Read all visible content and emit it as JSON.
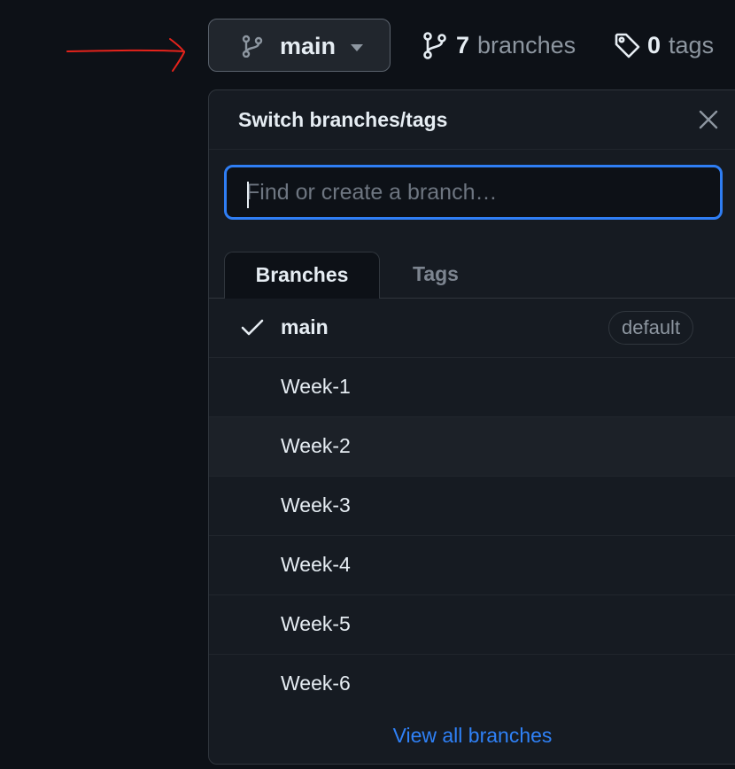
{
  "colors": {
    "accent": "#2f81f7",
    "annotation": "#e5231b",
    "background": "#0d1117",
    "panel": "#161b22"
  },
  "branch_button": {
    "icon": "git-branch-icon",
    "label": "main",
    "caret": "triangle-down-icon"
  },
  "repo_stats": {
    "branches": {
      "icon": "git-branch-icon",
      "count": "7",
      "label": "branches"
    },
    "tags": {
      "icon": "tag-icon",
      "count": "0",
      "label": "tags"
    }
  },
  "dropdown": {
    "title": "Switch branches/tags",
    "close_icon": "x-icon",
    "search": {
      "placeholder": "Find or create a branch…",
      "value": ""
    },
    "tabs": [
      {
        "label": "Branches",
        "active": true
      },
      {
        "label": "Tags",
        "active": false
      }
    ],
    "branches": [
      {
        "name": "main",
        "selected": true,
        "badge": "default"
      },
      {
        "name": "Week-1",
        "selected": false
      },
      {
        "name": "Week-2",
        "selected": false,
        "hovered": true
      },
      {
        "name": "Week-3",
        "selected": false
      },
      {
        "name": "Week-4",
        "selected": false
      },
      {
        "name": "Week-5",
        "selected": false
      },
      {
        "name": "Week-6",
        "selected": false
      }
    ],
    "footer_link": "View all branches"
  }
}
